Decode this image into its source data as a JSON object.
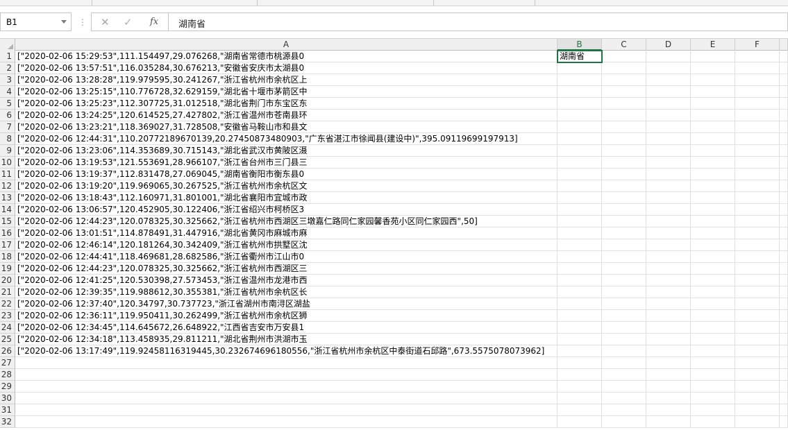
{
  "formula_bar": {
    "name_box": "B1",
    "separator": "⋮",
    "cancel_icon": "✕",
    "enter_icon": "✓",
    "fx_label": "fx",
    "value": "湖南省"
  },
  "columns": [
    "A",
    "B",
    "C",
    "D",
    "E",
    "F"
  ],
  "selected_cell": "B1",
  "rows": [
    {
      "n": "1",
      "a": "[\"2020-02-06 15:29:53\",111.154497,29.076268,\"湖南省常德市桃源县0",
      "b": "湖南省"
    },
    {
      "n": "2",
      "a": "[\"2020-02-06 13:57:51\",116.035284,30.676213,\"安徽省安庆市太湖县0",
      "b": ""
    },
    {
      "n": "3",
      "a": "[\"2020-02-06 13:28:28\",119.979595,30.241267,\"浙江省杭州市余杭区上",
      "b": ""
    },
    {
      "n": "4",
      "a": "[\"2020-02-06 13:25:15\",110.776728,32.629159,\"湖北省十堰市茅箭区中",
      "b": ""
    },
    {
      "n": "5",
      "a": "[\"2020-02-06 13:25:23\",112.307725,31.012518,\"湖北省荆门市东宝区东",
      "b": ""
    },
    {
      "n": "6",
      "a": "[\"2020-02-06 13:24:25\",120.614525,27.427802,\"浙江省温州市苍南县环",
      "b": ""
    },
    {
      "n": "7",
      "a": "[\"2020-02-06 13:23:21\",118.369027,31.728508,\"安徽省马鞍山市和县文",
      "b": ""
    },
    {
      "n": "8",
      "a": "[\"2020-02-06 12:44:31\",110.20772189670139,20.27450873480903,\"广东省湛江市徐闻县(建设中)\",395.09119699197913]",
      "b": ""
    },
    {
      "n": "9",
      "a": "[\"2020-02-06 13:23:06\",114.353689,30.715143,\"湖北省武汉市黄陂区滠",
      "b": ""
    },
    {
      "n": "10",
      "a": "[\"2020-02-06 13:19:53\",121.553691,28.966107,\"浙江省台州市三门县三",
      "b": ""
    },
    {
      "n": "11",
      "a": "[\"2020-02-06 13:19:37\",112.831478,27.069045,\"湖南省衡阳市衡东县0",
      "b": ""
    },
    {
      "n": "12",
      "a": "[\"2020-02-06 13:19:20\",119.969065,30.267525,\"浙江省杭州市余杭区文",
      "b": ""
    },
    {
      "n": "13",
      "a": "[\"2020-02-06 13:18:43\",112.160971,31.801001,\"湖北省襄阳市宜城市政",
      "b": ""
    },
    {
      "n": "14",
      "a": "[\"2020-02-06 13:06:57\",120.452905,30.122406,\"浙江省绍兴市柯桥区3",
      "b": ""
    },
    {
      "n": "15",
      "a": "[\"2020-02-06 12:44:23\",120.078325,30.325662,\"浙江省杭州市西湖区三墩嘉仁路同仁家园馨香苑小区同仁家园西\",50]",
      "b": ""
    },
    {
      "n": "16",
      "a": "[\"2020-02-06 13:01:51\",114.878491,31.447916,\"湖北省黄冈市麻城市麻",
      "b": ""
    },
    {
      "n": "17",
      "a": "[\"2020-02-06 12:46:14\",120.181264,30.342409,\"浙江省杭州市拱墅区沈",
      "b": ""
    },
    {
      "n": "18",
      "a": "[\"2020-02-06 12:44:41\",118.469681,28.682586,\"浙江省衢州市江山市0",
      "b": ""
    },
    {
      "n": "19",
      "a": "[\"2020-02-06 12:44:23\",120.078325,30.325662,\"浙江省杭州市西湖区三",
      "b": ""
    },
    {
      "n": "20",
      "a": "[\"2020-02-06 12:41:25\",120.530398,27.573453,\"浙江省温州市龙港市西",
      "b": ""
    },
    {
      "n": "21",
      "a": "[\"2020-02-06 12:39:35\",119.988612,30.355381,\"浙江省杭州市余杭区长",
      "b": ""
    },
    {
      "n": "22",
      "a": "[\"2020-02-06 12:37:40\",120.34797,30.737723,\"浙江省湖州市南浔区湖盐",
      "b": ""
    },
    {
      "n": "23",
      "a": "[\"2020-02-06 12:36:11\",119.950411,30.262499,\"浙江省杭州市余杭区狮",
      "b": ""
    },
    {
      "n": "24",
      "a": "[\"2020-02-06 12:34:45\",114.645672,26.648922,\"江西省吉安市万安县1",
      "b": ""
    },
    {
      "n": "25",
      "a": "[\"2020-02-06 12:34:18\",113.458935,29.811211,\"湖北省荆州市洪湖市玉",
      "b": ""
    },
    {
      "n": "26",
      "a": "[\"2020-02-06 13:17:49\",119.92458116319445,30.232674696180556,\"浙江省杭州市余杭区中泰街道石邱路\",673.5575078073962]",
      "b": ""
    },
    {
      "n": "27",
      "a": "",
      "b": ""
    },
    {
      "n": "28",
      "a": "",
      "b": ""
    },
    {
      "n": "29",
      "a": "",
      "b": ""
    },
    {
      "n": "30",
      "a": "",
      "b": ""
    },
    {
      "n": "31",
      "a": "",
      "b": ""
    },
    {
      "n": "32",
      "a": "",
      "b": ""
    }
  ]
}
